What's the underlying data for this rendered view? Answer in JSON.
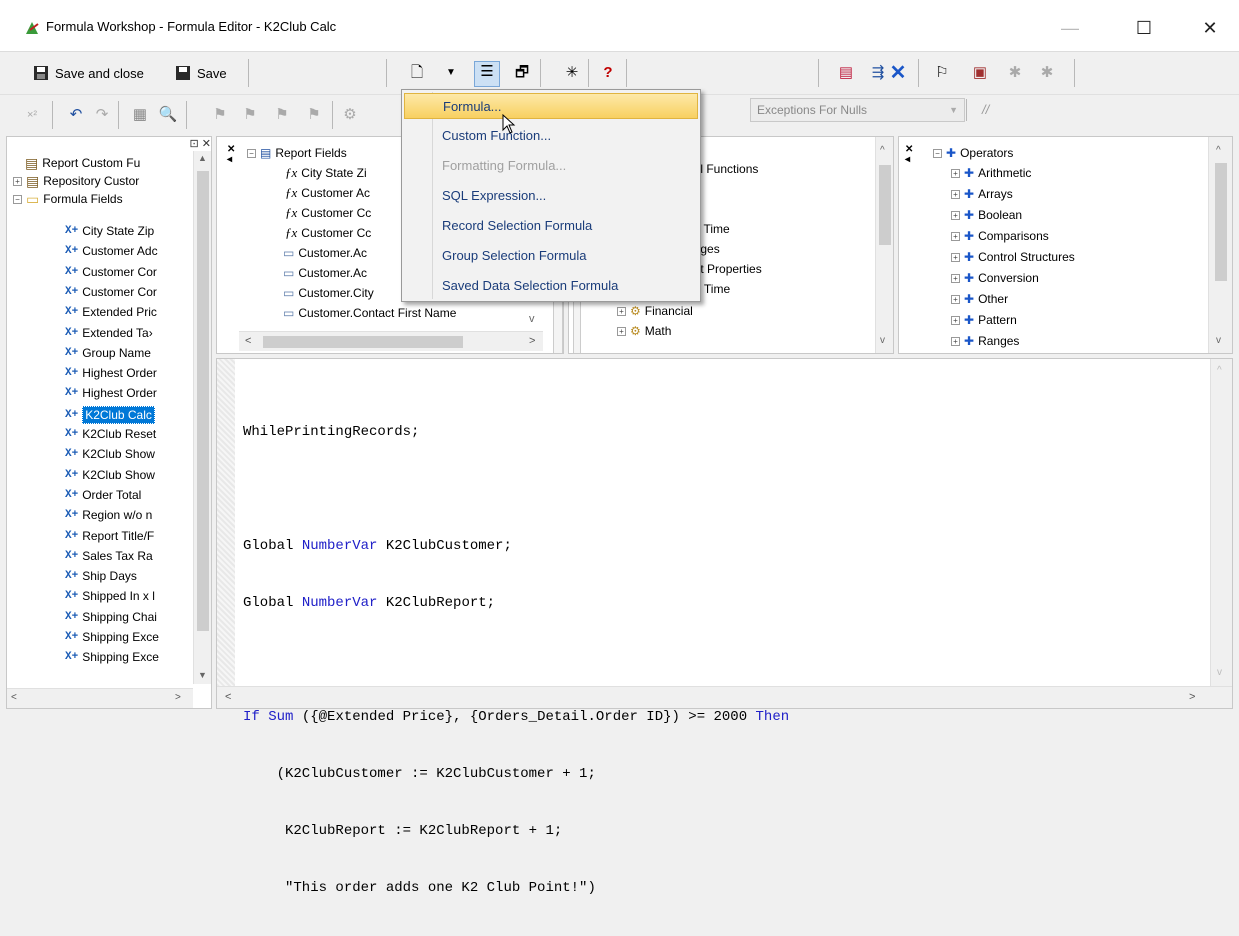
{
  "window": {
    "title": "Formula Workshop - Formula Editor - K2Club Calc",
    "minimize": "—",
    "maximize": "☐",
    "close": "✕"
  },
  "toolbar": {
    "save_close_label": "Save and close",
    "save_label": "Save",
    "help_glyph": "?",
    "exceptions_combo": "Exceptions For Nulls",
    "comment_glyph": "//"
  },
  "new_menu": {
    "items": [
      {
        "label": "Formula...",
        "state": "selected"
      },
      {
        "label": "Custom Function...",
        "state": "normal"
      },
      {
        "label": "Formatting Formula...",
        "state": "disabled"
      },
      {
        "label": "SQL Expression...",
        "state": "normal"
      },
      {
        "label": "Record Selection Formula",
        "state": "normal"
      },
      {
        "label": "Group Selection Formula",
        "state": "normal"
      },
      {
        "label": "Saved Data Selection Formula",
        "state": "normal"
      }
    ]
  },
  "workshop_tree": {
    "top_items": [
      "Report Custom Fu",
      "Repository Custor",
      "Formula Fields"
    ],
    "formulas": [
      "City State Zip",
      "Customer Adc",
      "Customer Cor",
      "Customer Cor",
      "Extended Pric",
      "Extended Ta›",
      "Group Name",
      "Highest Order",
      "Highest Order",
      "K2Club Calc",
      "K2Club Reset",
      "K2Club Show",
      "K2Club Show",
      "Order Total",
      "Region w/o n",
      "Report Title/F",
      "Sales Tax Ra",
      "Ship Days",
      "Shipped In x l",
      "Shipping Chai",
      "Shipping Exce",
      "Shipping Exce"
    ],
    "selected": "K2Club Calc"
  },
  "fields_tree": {
    "root": "Report Fields",
    "formula_items": [
      "City State Zi",
      "Customer Ac",
      "Customer Cc",
      "Customer Cc"
    ],
    "db_items": [
      "Customer.Ac",
      "Customer.Ac",
      "Customer.City",
      "Customer.Contact First Name"
    ]
  },
  "functions_tree": {
    "visible": [
      "nal Functions",
      "nd Time",
      "anges",
      "ent Properties",
      "Evaluation Time",
      "Financial",
      "Math"
    ]
  },
  "operators_tree": {
    "root": "Operators",
    "items": [
      "Arithmetic",
      "Arrays",
      "Boolean",
      "Comparisons",
      "Control Structures",
      "Conversion",
      "Other",
      "Pattern",
      "Ranges"
    ]
  },
  "code": {
    "l1": "WhilePrintingRecords;",
    "l2a": "Global ",
    "l2b": "NumberVar",
    "l2c": " K2ClubCustomer;",
    "l3a": "Global ",
    "l3b": "NumberVar",
    "l3c": " K2ClubReport;",
    "l4a": "If ",
    "l4b": "Sum",
    "l4c": " ({@Extended Price}, {Orders_Detail.Order ID}) >= 2000 ",
    "l4d": "Then",
    "l5": "    (K2ClubCustomer := K2ClubCustomer + 1;",
    "l6": "     K2ClubReport := K2ClubReport + 1;",
    "l7": "     \"This order adds one K2 Club Point!\")"
  },
  "colors": {
    "keyword": "#2020c8",
    "menu_highlight": "#f8d060",
    "icon_blue": "#1a5bb5"
  }
}
